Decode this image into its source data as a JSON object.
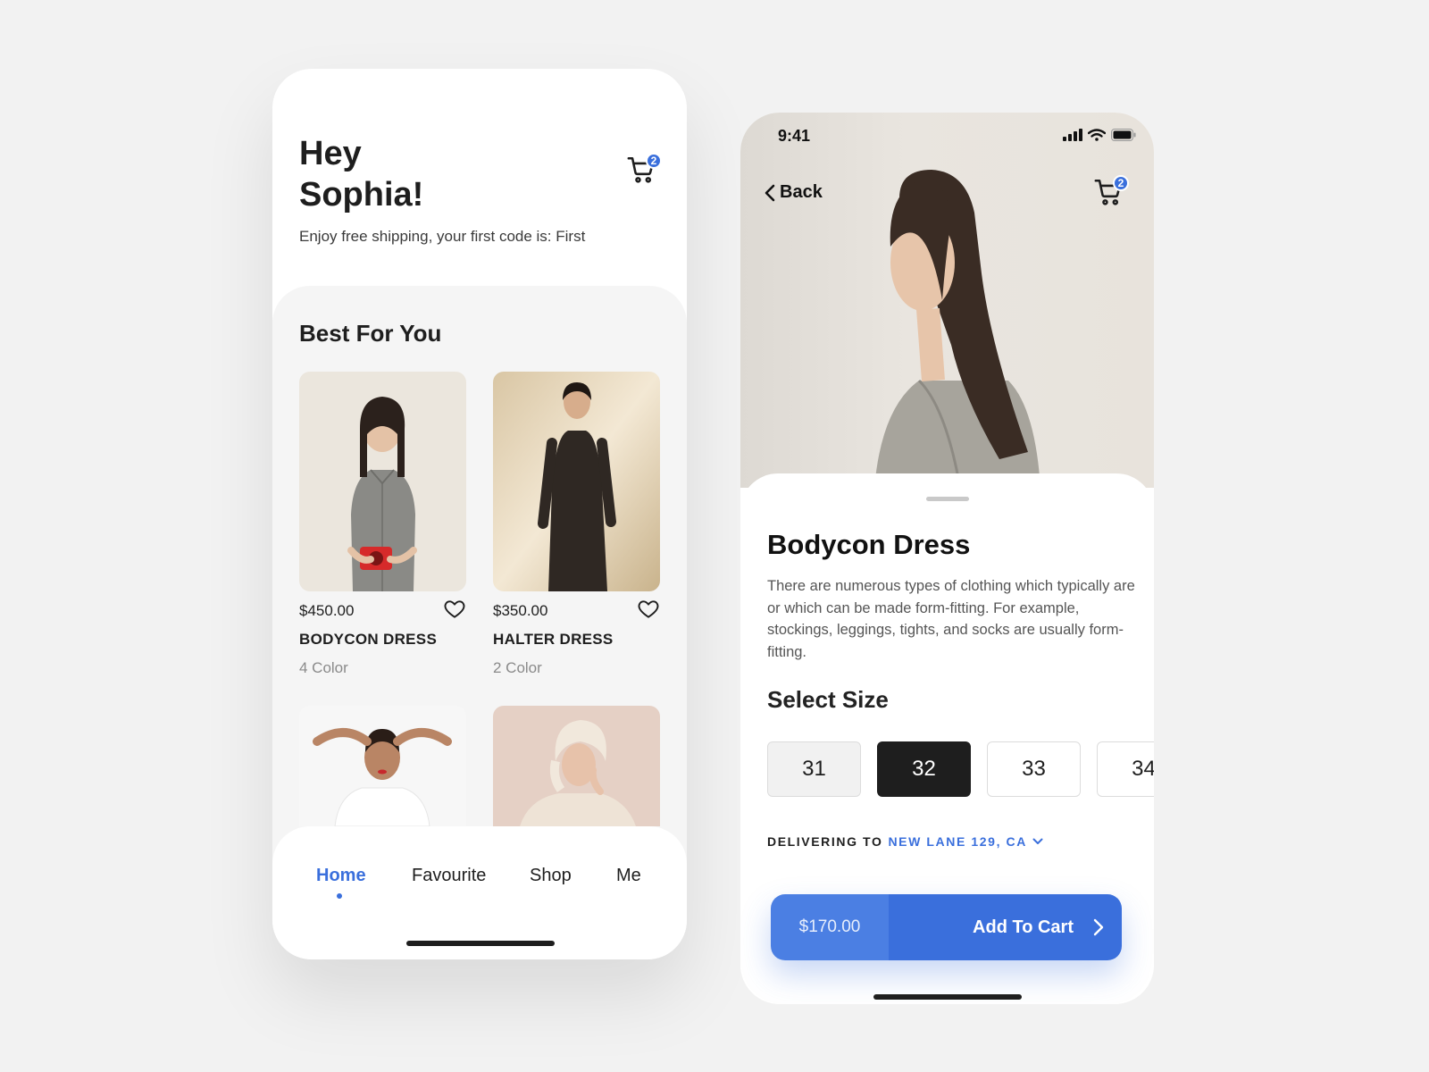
{
  "home": {
    "greeting_line1": "Hey",
    "greeting_line2": "Sophia!",
    "subtitle": "Enjoy free shipping, your first code is: First",
    "cart_count": "2",
    "section_title": "Best For You",
    "products": [
      {
        "price": "$450.00",
        "name": "BODYCON DRESS",
        "colors": "4 Color"
      },
      {
        "price": "$350.00",
        "name": "HALTER DRESS",
        "colors": "2 Color"
      }
    ],
    "nav": {
      "items": [
        "Home",
        "Favourite",
        "Shop",
        "Me"
      ],
      "active": "Home"
    }
  },
  "detail": {
    "status_time": "9:41",
    "back_label": "Back",
    "cart_count": "2",
    "title": "Bodycon Dress",
    "description": "There are numerous types of clothing which typically are or which can be made form-fitting. For example, stockings, leggings, tights, and socks are usually form-fitting.",
    "size_title": "Select Size",
    "sizes": [
      "31",
      "32",
      "33",
      "34"
    ],
    "selected_size": "32",
    "delivering_label": "DELIVERING TO",
    "delivering_address": "NEW LANE 129, CA",
    "price": "$170.00",
    "add_to_cart_label": "Add To Cart"
  },
  "colors": {
    "accent": "#3a6fdc",
    "dark": "#1e1e1e",
    "background": "#f2f2f2"
  }
}
